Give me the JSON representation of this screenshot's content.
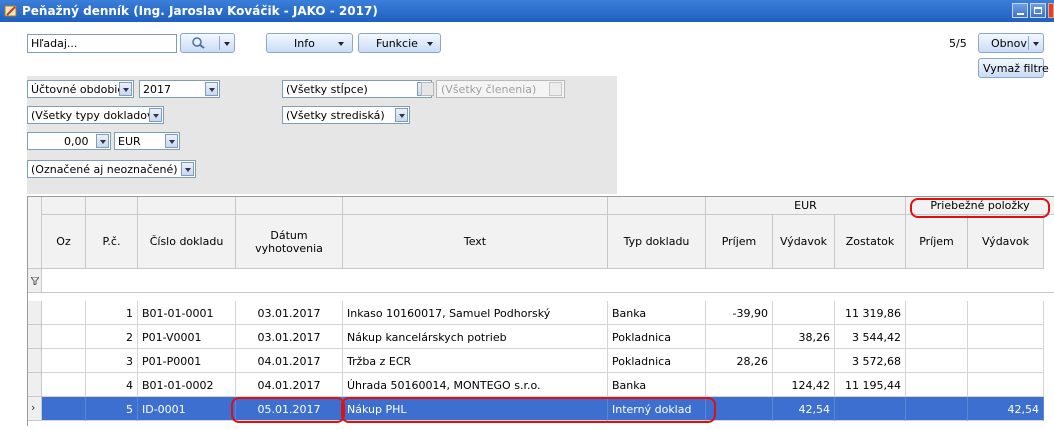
{
  "window": {
    "title": "Peňažný denník (Ing. Jaroslav Kováčik - JAKO - 2017)"
  },
  "toolbar": {
    "search_placeholder": "Hľadaj...",
    "info_label": "Info",
    "functions_label": "Funkcie",
    "page_counter": "5/5",
    "refresh_label": "Obnov",
    "clear_filters_label": "Vymaž filtre"
  },
  "filters": {
    "period_label": "Účtovné obdobie",
    "year": "2017",
    "columns": "(Všetky stĺpce)",
    "breakdown": "(Všetky členenia)",
    "doc_types": "(Všetky typy dokladov)",
    "centers": "(Všetky strediská)",
    "amount": "0,00",
    "currency": "EUR",
    "marked": "(Označené aj neoznačené)"
  },
  "grid": {
    "group_eur": "EUR",
    "group_running": "Priebežné položky",
    "columns": {
      "oz": "Oz",
      "pc": "P.č.",
      "doc_no": "Číslo dokladu",
      "date": "Dátum vyhotovenia",
      "text": "Text",
      "doc_type": "Typ dokladu",
      "income": "Príjem",
      "expense": "Výdavok",
      "balance": "Zostatok",
      "run_income": "Príjem",
      "run_expense": "Výdavok"
    },
    "rows": [
      {
        "pc": "1",
        "doc_no": "B01-01-0001",
        "date": "03.01.2017",
        "text": "Inkaso 10160017, Samuel Podhorský",
        "doc_type": "Banka",
        "income": "-39,90",
        "expense": "",
        "balance": "11 319,86",
        "run_income": "",
        "run_expense": ""
      },
      {
        "pc": "2",
        "doc_no": "P01-V0001",
        "date": "03.01.2017",
        "text": "Nákup kancelárskych potrieb",
        "doc_type": "Pokladnica",
        "income": "",
        "expense": "38,26",
        "balance": "3 544,42",
        "run_income": "",
        "run_expense": ""
      },
      {
        "pc": "3",
        "doc_no": "P01-P0001",
        "date": "04.01.2017",
        "text": "Tržba z ECR",
        "doc_type": "Pokladnica",
        "income": "28,26",
        "expense": "",
        "balance": "3 572,68",
        "run_income": "",
        "run_expense": ""
      },
      {
        "pc": "4",
        "doc_no": "B01-01-0002",
        "date": "04.01.2017",
        "text": "Úhrada 50160014, MONTEGO s.r.o.",
        "doc_type": "Banka",
        "income": "",
        "expense": "124,42",
        "balance": "11 195,44",
        "run_income": "",
        "run_expense": ""
      },
      {
        "pc": "5",
        "doc_no": "ID-0001",
        "date": "05.01.2017",
        "text": "Nákup PHL",
        "doc_type": "Interný doklad",
        "income": "",
        "expense": "42,54",
        "balance": "",
        "run_income": "",
        "run_expense": "42,54"
      }
    ]
  },
  "colors": {
    "titlebar": "#1f5fbf",
    "selected_row": "#3c6fd0",
    "highlight": "#e01010"
  }
}
